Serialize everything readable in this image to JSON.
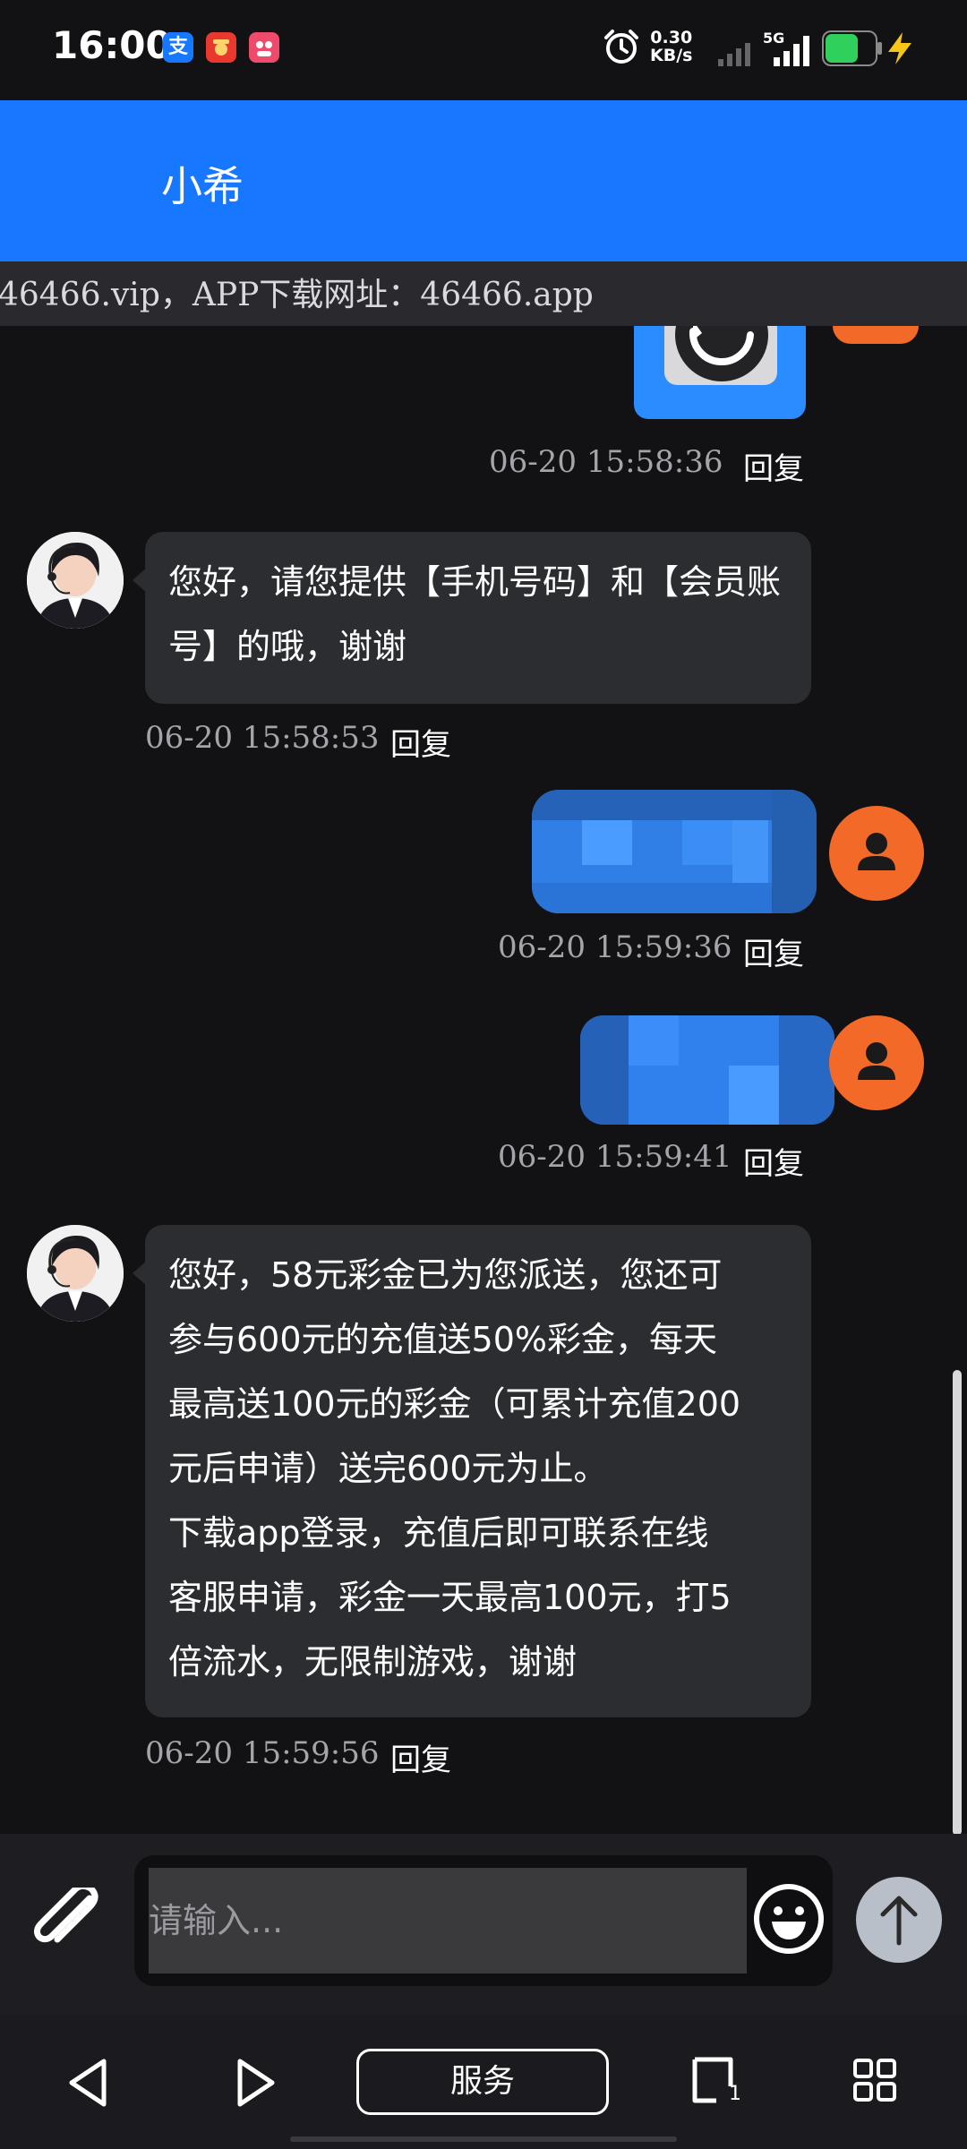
{
  "status_bar": {
    "time": "16:00",
    "apps": [
      {
        "icon": "alipay-icon",
        "label": "支",
        "color": "#1677ff"
      },
      {
        "icon": "red-app-icon",
        "label": "",
        "color": "#e8382f"
      },
      {
        "icon": "pink-app-icon",
        "label": "",
        "color": "#ee4a6c"
      }
    ],
    "net_speed_value": "0.30",
    "net_speed_unit": "KB/s",
    "network": "5G",
    "battery_color": "#2fd15c"
  },
  "header": {
    "title": "小希",
    "color": "#1777ff"
  },
  "marquee": {
    "text": "46466.vip，APP下载网址：46466.app"
  },
  "messages": [
    {
      "side": "right",
      "content": "image",
      "time": "06-20 15:58:36",
      "reply": "回复"
    },
    {
      "side": "left",
      "text": "您好，请您提供【手机号码】和【会员账号】的哦，谢谢",
      "time": "06-20 15:58:53",
      "reply": "回复"
    },
    {
      "side": "right",
      "content": "blurred",
      "time": "06-20 15:59:36",
      "reply": "回复"
    },
    {
      "side": "right",
      "content": "blurred",
      "time": "06-20 15:59:41",
      "reply": "回复"
    },
    {
      "side": "left",
      "lines": [
        "您好，58元彩金已为您派送，您还可",
        "参与600元的充值送50%彩金，每天",
        "最高送100元的彩金（可累计充值200",
        "元后申请）送完600元为止。",
        "下载app登录，充值后即可联系在线",
        "客服申请，彩金一天最高100元，打5",
        "倍流水，无限制游戏，谢谢"
      ],
      "time": "06-20 15:59:56",
      "reply": "回复"
    }
  ],
  "input": {
    "placeholder": "请输入..."
  },
  "nav": {
    "service_label": "服务",
    "tabs_count": "1"
  },
  "colors": {
    "accent": "#1777ff",
    "user_avatar": "#f36a28",
    "bubble": "#2b2d31"
  }
}
